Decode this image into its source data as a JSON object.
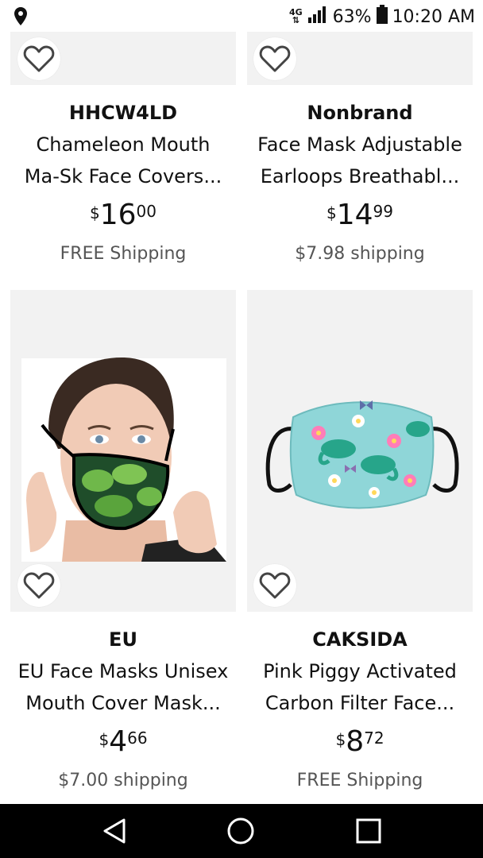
{
  "status_bar": {
    "network": "4G",
    "battery": "63%",
    "time": "10:20 AM"
  },
  "products": [
    {
      "brand": "HHCW4LD",
      "title_line1": "Chameleon Mouth",
      "title_line2": "Ma-Sk Face Covers...",
      "price_currency": "$",
      "price_whole": "16",
      "price_fraction": "00",
      "shipping": "FREE Shipping"
    },
    {
      "brand": "Nonbrand",
      "title_line1": "Face Mask Adjustable",
      "title_line2": "Earloops Breathabl...",
      "price_currency": "$",
      "price_whole": "14",
      "price_fraction": "99",
      "shipping": "$7.98 shipping"
    },
    {
      "brand": "EU",
      "title_line1": "EU Face Masks Unisex",
      "title_line2": "Mouth Cover Mask...",
      "price_currency": "$",
      "price_whole": "4",
      "price_fraction": "66",
      "shipping": "$7.00 shipping"
    },
    {
      "brand": "CAKSIDA",
      "title_line1": "Pink Piggy Activated",
      "title_line2": "Carbon Filter Face...",
      "price_currency": "$",
      "price_whole": "8",
      "price_fraction": "72",
      "shipping": "FREE Shipping"
    }
  ],
  "icons": {
    "location": "location-pin-icon",
    "signal": "signal-icon",
    "battery": "battery-icon",
    "favorite": "heart-outline-icon",
    "back": "back-triangle-icon",
    "home": "home-circle-icon",
    "recents": "recents-square-icon"
  }
}
